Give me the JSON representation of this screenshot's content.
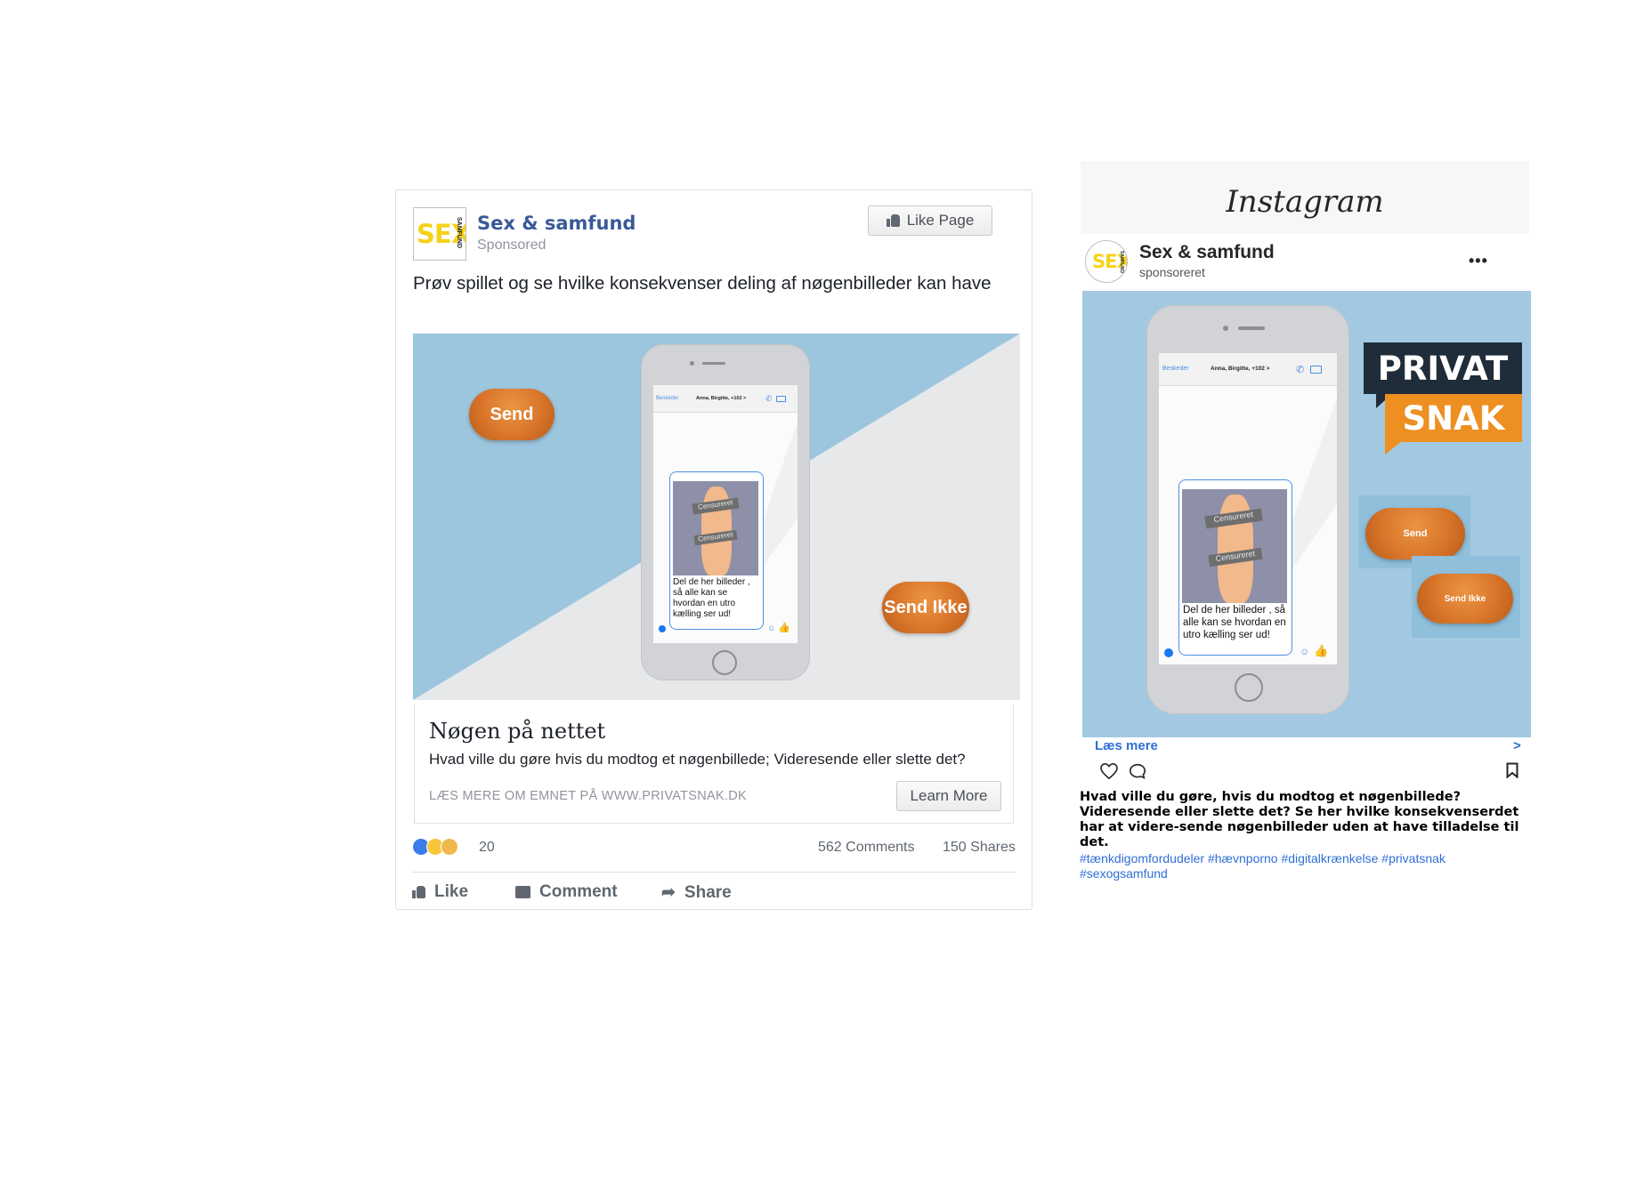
{
  "facebook": {
    "page_name": "Sex & samfund",
    "sponsored": "Sponsored",
    "logo_text": "SEX",
    "logo_side_text": "SAMFUND",
    "like_page_label": "Like Page",
    "post_text": "Prøv spillet og se hvilke konsekvenser deling af nøgenbilleder kan have",
    "hero": {
      "send_label": "Send",
      "send_ikke_label": "Send Ikke",
      "chat_back": "Beskeder",
      "chat_header": "Anna, Birgitte, +102 >",
      "censor_1": "Censureret",
      "censor_2": "Censureret",
      "message": "Del de her billeder , så alle kan se hvordan en utro kælling ser ud!"
    },
    "link_title": "Nøgen på nettet",
    "link_description": "Hvad ville du gøre hvis du modtog et nøgenbillede; Videresende eller slette det?",
    "link_caption": "LÆS MERE OM EMNET PÅ WWW.PRIVATSNAK.DK",
    "learn_more_label": "Learn More",
    "reactions_count": "20",
    "comments": "562 Comments",
    "shares": "150 Shares",
    "actions": {
      "like": "Like",
      "comment": "Comment",
      "share": "Share"
    },
    "colors": {
      "brand_blue": "#3b5998",
      "hero_blue": "#9cc5de",
      "orange": "#d9752a"
    }
  },
  "instagram": {
    "app_title": "Instagram",
    "account_name": "Sex & samfund",
    "sponsored": "sponsoreret",
    "logo_text": "SEX",
    "logo_side_text": "SAMFUND",
    "more_label": "•••",
    "hero": {
      "privat": "PRIVAT",
      "snak": "SNAK",
      "send_label": "Send",
      "send_ikke_label": "Send Ikke",
      "chat_back": "Beskeder",
      "chat_header": "Anna, Birgitte, +102 >",
      "censor_1": "Censureret",
      "censor_2": "Censureret",
      "message": "Del de her billeder , så alle kan se hvordan en utro kælling ser ud!"
    },
    "read_more": "Læs mere",
    "read_more_arrow": ">",
    "caption": "Hvad ville du gøre, hvis du modtog et nøgenbillede? Videresende eller slette det? Se her hvilke konsekvenserdet har at videre-sende nøgenbilleder uden at have tilladelse til det.",
    "hashtags_line1": "#tænkdigomfordudeler #hævnporno #digitalkrænkelse #privatsnak",
    "hashtags_line2": "#sexogsamfund",
    "colors": {
      "link_blue": "#2f6fd6",
      "hero_blue": "#a2c9e1",
      "privat_bg": "#1f2d3a",
      "snak_bg": "#ee8f22"
    }
  }
}
